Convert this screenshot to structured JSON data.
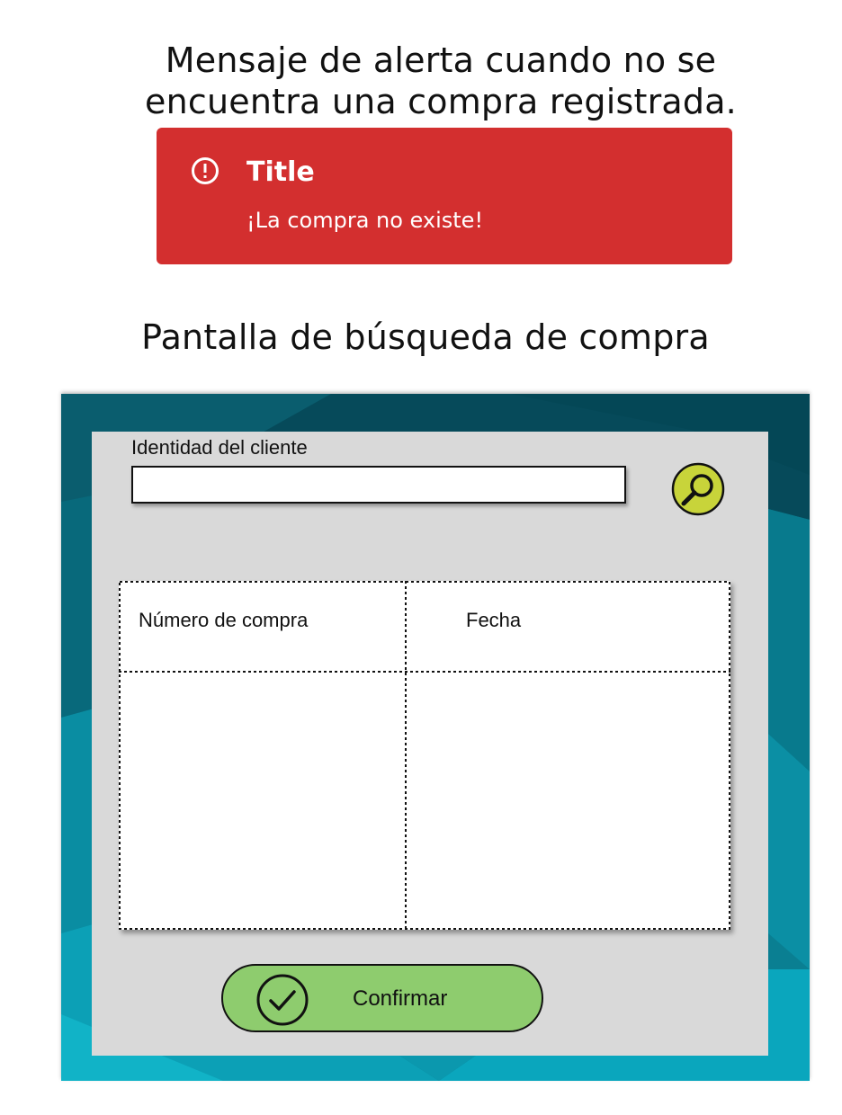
{
  "captions": {
    "alert_line_1": "Mensaje de alerta cuando no se",
    "alert_line_2": "encuentra una compra registrada.",
    "screen_caption": "Pantalla de búsqueda de compra"
  },
  "alert": {
    "icon": "exclamation-circle-icon",
    "title": "Title",
    "message": "¡La compra no existe!",
    "color": "#d32f2f"
  },
  "search_form": {
    "label": "Identidad del cliente",
    "value": "",
    "placeholder": "",
    "search_icon": "magnifier-icon",
    "search_button_color": "#c8d43a"
  },
  "table": {
    "columns": [
      "Número de compra",
      "Fecha"
    ],
    "rows": []
  },
  "confirm_button": {
    "label": "Confirmar",
    "icon": "check-circle-icon",
    "color": "#8ecc6e"
  },
  "colors": {
    "panel": "#d9d9d9",
    "background_dark": "#064a5a",
    "background_light": "#0aa6bd"
  }
}
